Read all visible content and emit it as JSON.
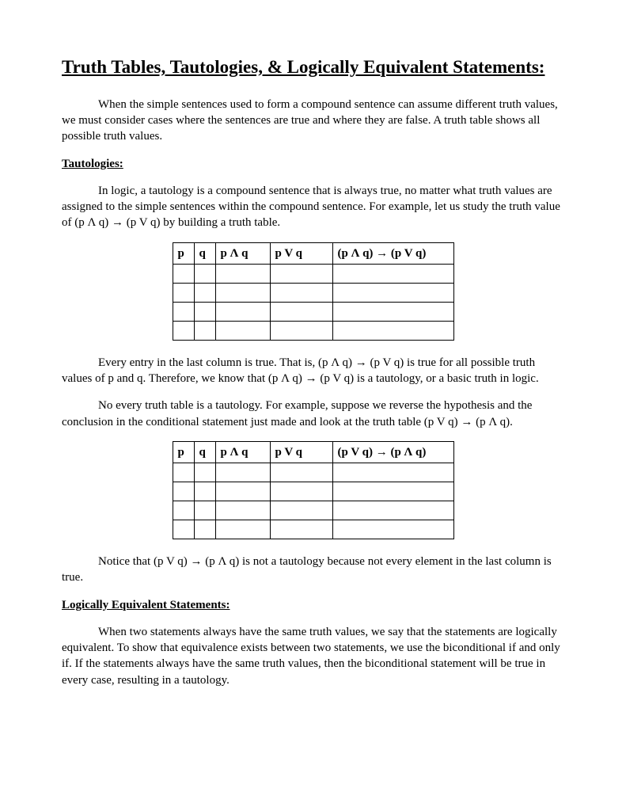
{
  "title": "Truth Tables, Tautologies, & Logically Equivalent Statements:",
  "intro": "When the simple sentences used to form a compound sentence can assume different truth values, we must consider cases where the sentences are true and where they are false.  A truth table shows all possible truth values.",
  "tautologies_heading": "Tautologies:",
  "tautology_para": "In logic, a tautology is a compound sentence that is always true, no matter what truth values are assigned to the simple sentences within the compound sentence.  For example, let us study the truth value of (p Λ q) → (p V q) by building a truth table.",
  "table1": {
    "headers": [
      "p",
      "q",
      "p Λ q",
      "p V q",
      "(p Λ q) → (p V q)"
    ],
    "rows": [
      [
        "",
        "",
        "",
        "",
        ""
      ],
      [
        "",
        "",
        "",
        "",
        ""
      ],
      [
        "",
        "",
        "",
        "",
        ""
      ],
      [
        "",
        "",
        "",
        "",
        ""
      ]
    ]
  },
  "after_table1_a": "Every entry in the last column is true.  That is, (p Λ q) → (p V q) is true for all possible truth values of p and q.  Therefore, we know that (p Λ q) → (p V q) is a tautology, or a basic truth in logic.",
  "after_table1_b": "No every truth table is a tautology.  For example, suppose we reverse the hypothesis and the conclusion in the conditional statement just made and look at the truth table (p V q) → (p Λ q).",
  "table2": {
    "headers": [
      "p",
      "q",
      "p Λ q",
      "p V q",
      "(p V q) → (p Λ q)"
    ],
    "rows": [
      [
        "",
        "",
        "",
        "",
        ""
      ],
      [
        "",
        "",
        "",
        "",
        ""
      ],
      [
        "",
        "",
        "",
        "",
        ""
      ],
      [
        "",
        "",
        "",
        "",
        ""
      ]
    ]
  },
  "after_table2": "Notice that (p V q) → (p Λ q) is not a tautology because not every element in the last column is true.",
  "logequiv_heading": "Logically Equivalent Statements:",
  "logequiv_para": "When two statements always have the same truth values, we say that the statements are logically equivalent.  To show that equivalence exists between two statements, we use the biconditional if and only if.  If the statements always have the same truth values, then the biconditional statement will be true in every case, resulting in a tautology."
}
